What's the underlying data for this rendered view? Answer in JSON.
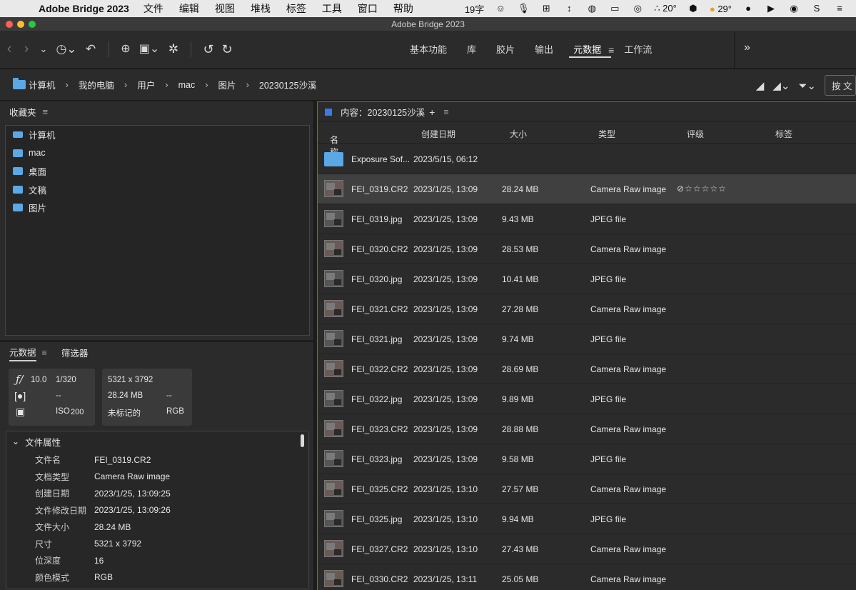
{
  "menubar": {
    "app_name": "Adobe Bridge 2023",
    "menus": [
      "文件",
      "编辑",
      "视图",
      "堆栈",
      "标签",
      "工具",
      "窗口",
      "帮助"
    ],
    "input_status": "19字",
    "weather_1": "20°",
    "weather_2": "29°"
  },
  "window": {
    "title": "Adobe Bridge 2023"
  },
  "workspaces": {
    "items": [
      "基本功能",
      "库",
      "胶片",
      "输出",
      "元数据",
      "工作流"
    ],
    "active": "元数据"
  },
  "breadcrumb": [
    "计算机",
    "我的电脑",
    "用户",
    "mac",
    "图片",
    "20230125沙溪"
  ],
  "sort_button": "按 文",
  "favorites": {
    "title": "收藏夹",
    "items": [
      "计算机",
      "mac",
      "桌面",
      "文稿",
      "图片"
    ]
  },
  "metadata_panel": {
    "tabs": [
      "元数据",
      "筛选器"
    ],
    "camera": {
      "aperture": "10.0",
      "shutter": "1/320",
      "dims": "5321 x 3792",
      "metering": "--",
      "size": "28.24 MB",
      "size_extra": "--",
      "iso_label": "ISO",
      "iso": "200",
      "label_state": "未标记的",
      "color": "RGB"
    },
    "file_props_title": "文件属性",
    "file_props": [
      {
        "label": "文件名",
        "value": "FEI_0319.CR2"
      },
      {
        "label": "文档类型",
        "value": "Camera Raw image"
      },
      {
        "label": "创建日期",
        "value": "2023/1/25, 13:09:25"
      },
      {
        "label": "文件修改日期",
        "value": "2023/1/25, 13:09:26"
      },
      {
        "label": "文件大小",
        "value": "28.24 MB"
      },
      {
        "label": "尺寸",
        "value": "5321 x 3792"
      },
      {
        "label": "位深度",
        "value": "16"
      },
      {
        "label": "颜色模式",
        "value": "RGB"
      }
    ]
  },
  "content": {
    "title": "内容：20230125沙溪",
    "columns": [
      "名称",
      "创建日期",
      "大小",
      "类型",
      "评级",
      "标签"
    ],
    "rows": [
      {
        "name": "Exposure Sof...",
        "date": "2023/5/15, 06:12",
        "size": "",
        "type": "",
        "kind": "folder"
      },
      {
        "name": "FEI_0319.CR2",
        "date": "2023/1/25, 13:09",
        "size": "28.24 MB",
        "type": "Camera Raw image",
        "kind": "warm",
        "rating": "⊘☆☆☆☆☆"
      },
      {
        "name": "FEI_0319.jpg",
        "date": "2023/1/25, 13:09",
        "size": "9.43 MB",
        "type": "JPEG file",
        "kind": "dark"
      },
      {
        "name": "FEI_0320.CR2",
        "date": "2023/1/25, 13:09",
        "size": "28.53 MB",
        "type": "Camera Raw image",
        "kind": "warm"
      },
      {
        "name": "FEI_0320.jpg",
        "date": "2023/1/25, 13:09",
        "size": "10.41 MB",
        "type": "JPEG file",
        "kind": "dark"
      },
      {
        "name": "FEI_0321.CR2",
        "date": "2023/1/25, 13:09",
        "size": "27.28 MB",
        "type": "Camera Raw image",
        "kind": "warm"
      },
      {
        "name": "FEI_0321.jpg",
        "date": "2023/1/25, 13:09",
        "size": "9.74 MB",
        "type": "JPEG file",
        "kind": "dark"
      },
      {
        "name": "FEI_0322.CR2",
        "date": "2023/1/25, 13:09",
        "size": "28.69 MB",
        "type": "Camera Raw image",
        "kind": "warm"
      },
      {
        "name": "FEI_0322.jpg",
        "date": "2023/1/25, 13:09",
        "size": "9.89 MB",
        "type": "JPEG file",
        "kind": "dark"
      },
      {
        "name": "FEI_0323.CR2",
        "date": "2023/1/25, 13:09",
        "size": "28.88 MB",
        "type": "Camera Raw image",
        "kind": "warm"
      },
      {
        "name": "FEI_0323.jpg",
        "date": "2023/1/25, 13:09",
        "size": "9.58 MB",
        "type": "JPEG file",
        "kind": "dark"
      },
      {
        "name": "FEI_0325.CR2",
        "date": "2023/1/25, 13:10",
        "size": "27.57 MB",
        "type": "Camera Raw image",
        "kind": "warm"
      },
      {
        "name": "FEI_0325.jpg",
        "date": "2023/1/25, 13:10",
        "size": "9.94 MB",
        "type": "JPEG file",
        "kind": "dark"
      },
      {
        "name": "FEI_0327.CR2",
        "date": "2023/1/25, 13:10",
        "size": "27.43 MB",
        "type": "Camera Raw image",
        "kind": "warm"
      },
      {
        "name": "FEI_0330.CR2",
        "date": "2023/1/25, 13:11",
        "size": "25.05 MB",
        "type": "Camera Raw image",
        "kind": "warm"
      }
    ],
    "selected_index": 1
  }
}
